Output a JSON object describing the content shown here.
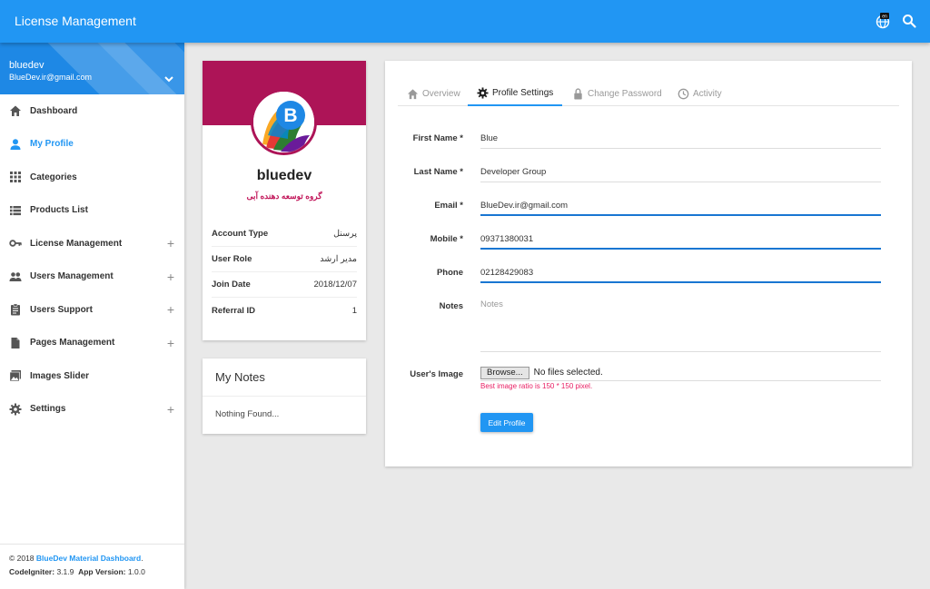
{
  "app": {
    "title": "License Management"
  },
  "topbar": {
    "lang_badge": "en"
  },
  "colors": {
    "primary": "#2196f3",
    "profile_cover": "#ad1457",
    "hint": "#e91e63"
  },
  "user": {
    "name": "bluedev",
    "email": "BlueDev.ir@gmail.com"
  },
  "sidebar": {
    "items": [
      {
        "label": "Dashboard",
        "icon": "home-icon",
        "expandable": false
      },
      {
        "label": "My Profile",
        "icon": "person-icon",
        "expandable": false,
        "active": true
      },
      {
        "label": "Categories",
        "icon": "grid-icon",
        "expandable": false
      },
      {
        "label": "Products List",
        "icon": "list-icon",
        "expandable": false
      },
      {
        "label": "License Management",
        "icon": "key-icon",
        "expandable": true
      },
      {
        "label": "Users Management",
        "icon": "people-icon",
        "expandable": true
      },
      {
        "label": "Users Support",
        "icon": "clipboard-icon",
        "expandable": true
      },
      {
        "label": "Pages Management",
        "icon": "document-icon",
        "expandable": true
      },
      {
        "label": "Images Slider",
        "icon": "image-icon",
        "expandable": false
      },
      {
        "label": "Settings",
        "icon": "gear-icon",
        "expandable": true
      }
    ],
    "plus": "+"
  },
  "footer": {
    "copyright": "© 2018",
    "brand": "BlueDev Material Dashboard",
    "period": ".",
    "ci_label": "CodeIgniter:",
    "ci_version": "3.1.9",
    "app_label": "App Version:",
    "app_version": "1.0.0"
  },
  "profile": {
    "name": "bluedev",
    "subtitle": "گروه توسعه دهنده آبی",
    "logo_letter": "B",
    "info": [
      {
        "key": "Account Type",
        "value": "پرسنل"
      },
      {
        "key": "User Role",
        "value": "مدیر ارشد"
      },
      {
        "key": "Join Date",
        "value": "2018/12/07"
      },
      {
        "key": "Referral ID",
        "value": "1"
      }
    ]
  },
  "notes": {
    "title": "My Notes",
    "empty": "Nothing Found..."
  },
  "tabs": [
    {
      "label": "Overview",
      "icon": "home-icon"
    },
    {
      "label": "Profile Settings",
      "icon": "gear-icon",
      "active": true
    },
    {
      "label": "Change Password",
      "icon": "lock-icon"
    },
    {
      "label": "Activity",
      "icon": "clock-icon"
    }
  ],
  "form": {
    "first_name": {
      "label": "First Name *",
      "value": "Blue"
    },
    "last_name": {
      "label": "Last Name *",
      "value": "Developer Group"
    },
    "email": {
      "label": "Email *",
      "value": "BlueDev.ir@gmail.com"
    },
    "mobile": {
      "label": "Mobile *",
      "value": "09371380031"
    },
    "phone": {
      "label": "Phone",
      "value": "02128429083"
    },
    "notes": {
      "label": "Notes",
      "placeholder": "Notes"
    },
    "image": {
      "label": "User's Image",
      "browse": "Browse...",
      "status": "No files selected.",
      "hint": "Best image ratio is 150 * 150 pixel."
    },
    "submit": "Edit Profile"
  }
}
